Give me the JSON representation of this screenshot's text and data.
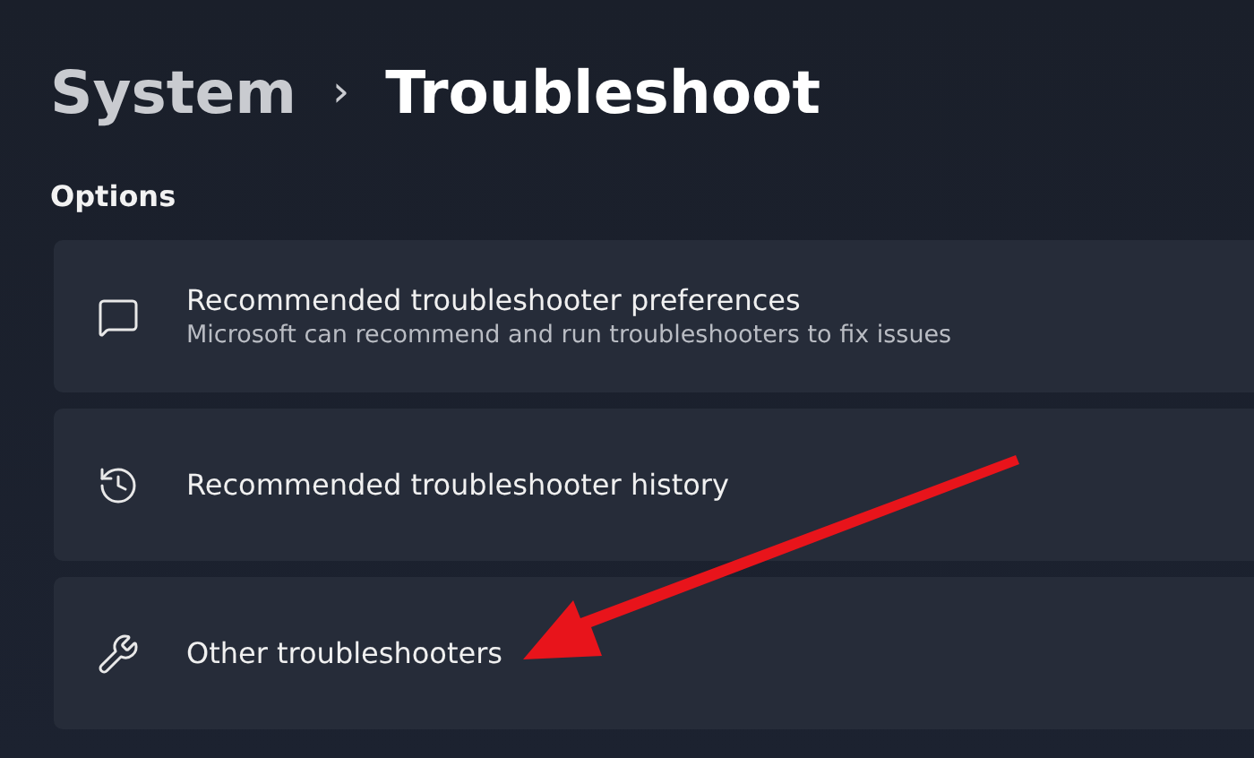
{
  "breadcrumb": {
    "parent": "System",
    "separator": "›",
    "current": "Troubleshoot"
  },
  "section_title": "Options",
  "options": [
    {
      "title": "Recommended troubleshooter preferences",
      "description": "Microsoft can recommend and run troubleshooters to fix issues"
    },
    {
      "title": "Recommended troubleshooter history"
    },
    {
      "title": "Other troubleshooters"
    }
  ]
}
